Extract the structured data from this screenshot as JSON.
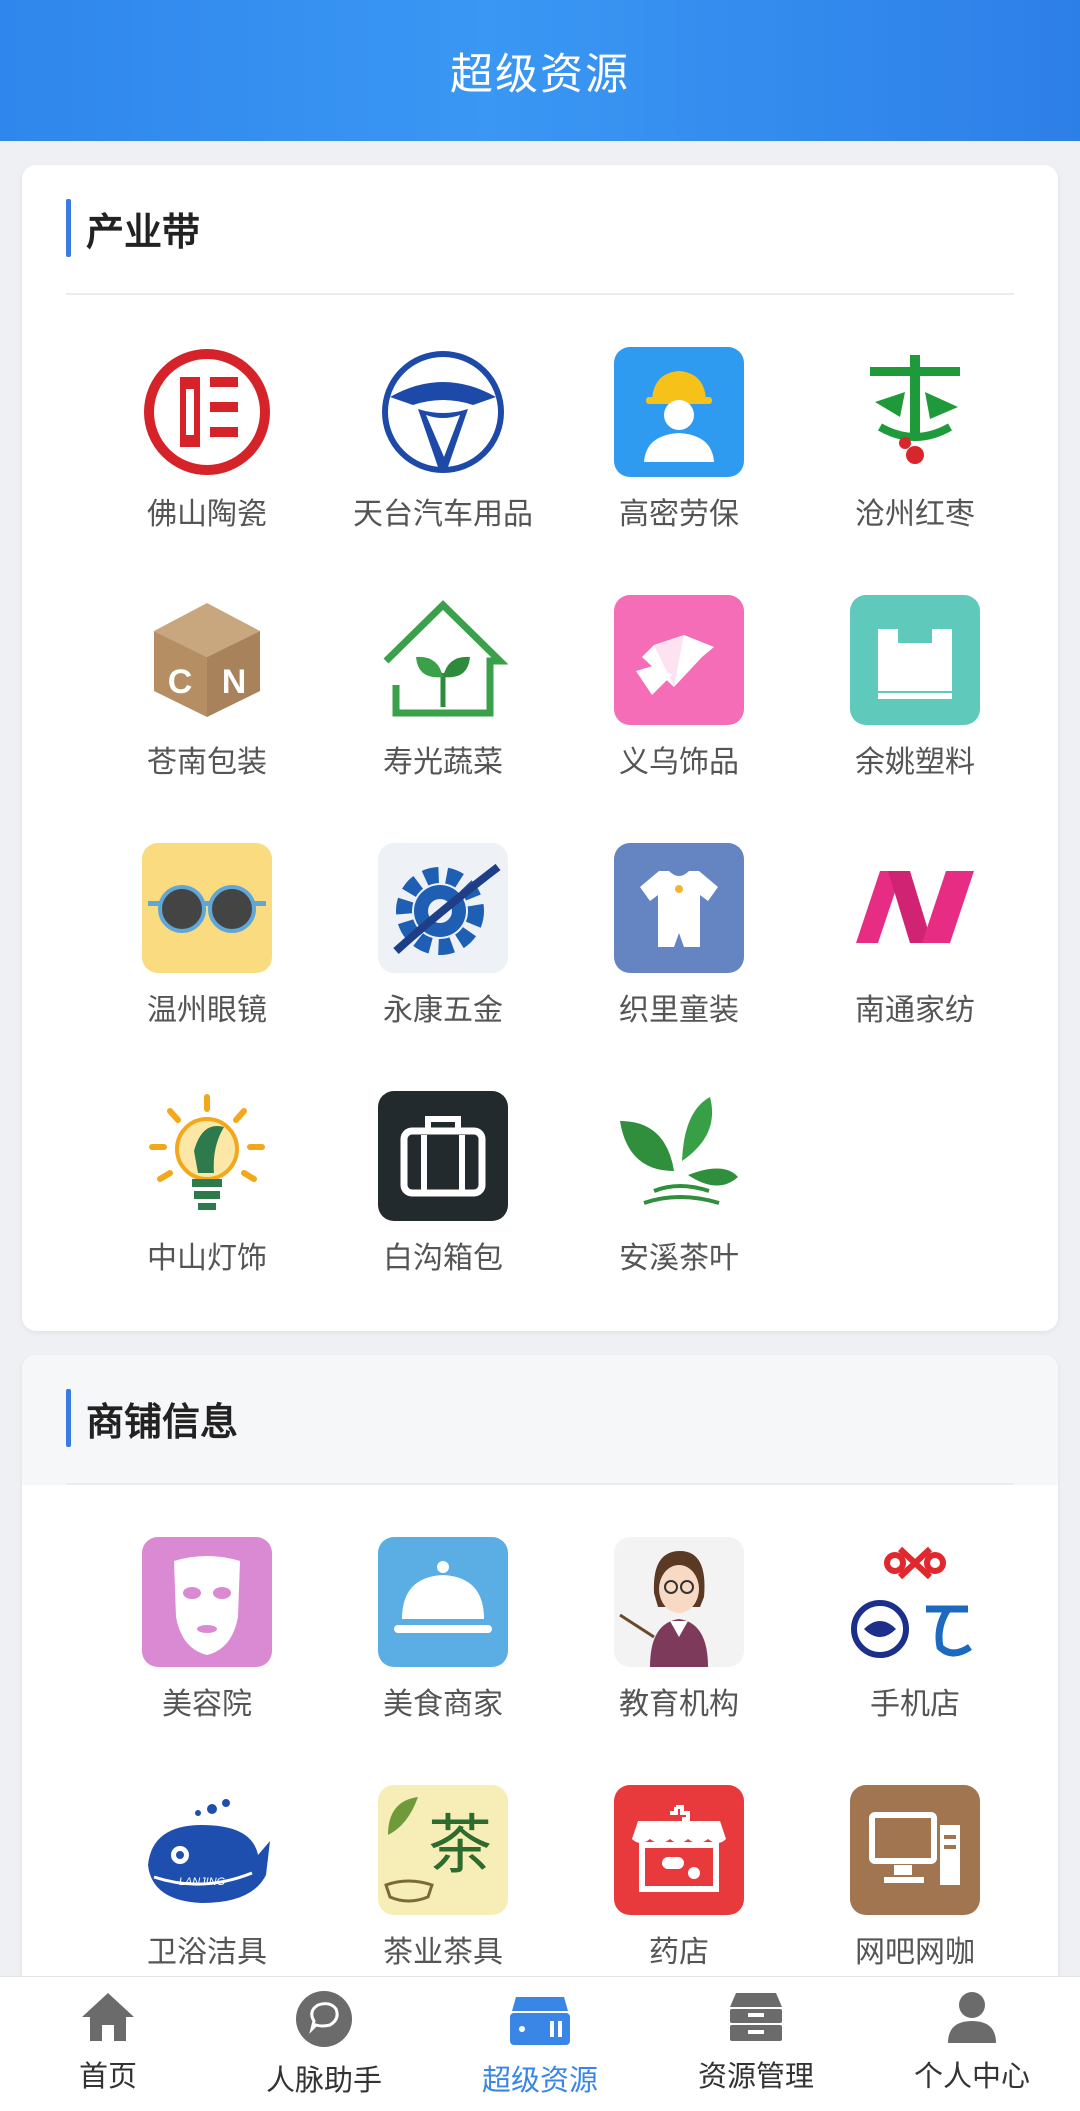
{
  "header": {
    "title": "超级资源"
  },
  "sections": {
    "industry": {
      "title": "产业带",
      "items": [
        {
          "label": "佛山陶瓷",
          "icon": "foshan-ceramic-logo-icon"
        },
        {
          "label": "天台汽车用品",
          "icon": "steering-wheel-icon"
        },
        {
          "label": "高密劳保",
          "icon": "worker-helmet-icon"
        },
        {
          "label": "沧州红枣",
          "icon": "jujube-logo-icon"
        },
        {
          "label": "苍南包装",
          "icon": "cn-box-icon"
        },
        {
          "label": "寿光蔬菜",
          "icon": "sprout-house-icon"
        },
        {
          "label": "义乌饰品",
          "icon": "diamond-icon"
        },
        {
          "label": "余姚塑料",
          "icon": "plastic-bag-icon"
        },
        {
          "label": "温州眼镜",
          "icon": "sunglasses-icon"
        },
        {
          "label": "永康五金",
          "icon": "gear-icon"
        },
        {
          "label": "织里童装",
          "icon": "baby-clothes-icon"
        },
        {
          "label": "南通家纺",
          "icon": "n-letter-logo-icon"
        },
        {
          "label": "中山灯饰",
          "icon": "light-bulb-icon"
        },
        {
          "label": "白沟箱包",
          "icon": "suitcase-icon"
        },
        {
          "label": "安溪茶叶",
          "icon": "tea-leaf-icon"
        }
      ]
    },
    "shops": {
      "title": "商铺信息",
      "items": [
        {
          "label": "美容院",
          "icon": "face-mask-icon"
        },
        {
          "label": "美食商家",
          "icon": "food-cloche-icon"
        },
        {
          "label": "教育机构",
          "icon": "teacher-icon"
        },
        {
          "label": "手机店",
          "icon": "carrier-logos-icon"
        },
        {
          "label": "卫浴洁具",
          "icon": "whale-logo-icon"
        },
        {
          "label": "茶业茶具",
          "icon": "tea-character-icon"
        },
        {
          "label": "药店",
          "icon": "pharmacy-icon"
        },
        {
          "label": "网吧网咖",
          "icon": "computer-icon"
        }
      ]
    }
  },
  "tabbar": {
    "items": [
      {
        "label": "首页",
        "icon": "home-icon"
      },
      {
        "label": "人脉助手",
        "icon": "chat-icon"
      },
      {
        "label": "超级资源",
        "icon": "database-icon",
        "active": true
      },
      {
        "label": "资源管理",
        "icon": "archive-icon"
      },
      {
        "label": "个人中心",
        "icon": "user-icon"
      }
    ]
  },
  "colors": {
    "accent": "#3a86e6",
    "header": "#2f86ec"
  }
}
